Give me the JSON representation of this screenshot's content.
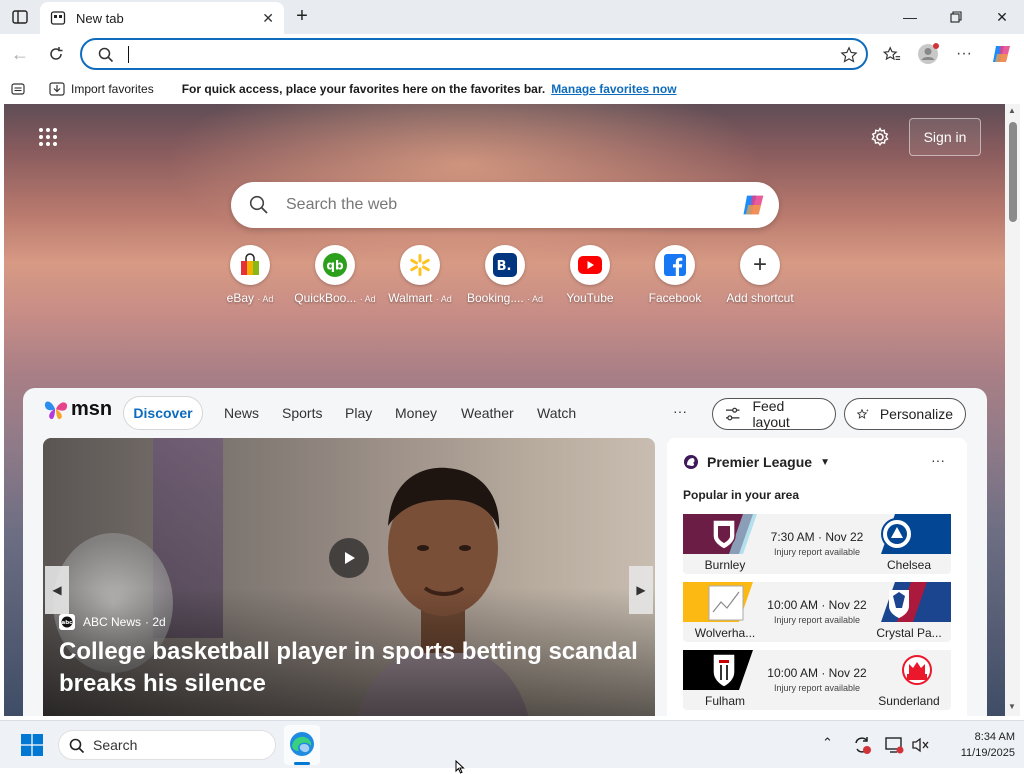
{
  "browser": {
    "tab_title": "New tab",
    "address_value": "",
    "favorites_bar": {
      "import_label": "Import favorites",
      "hint": "For quick access, place your favorites here on the favorites bar.",
      "manage_link": "Manage favorites now"
    }
  },
  "msn": {
    "sign_in": "Sign in",
    "search_placeholder": "Search the web",
    "shortcuts": [
      {
        "label": "eBay",
        "ad": "· Ad",
        "icon": "ebay-icon"
      },
      {
        "label": "QuickBoo...",
        "ad": "· Ad",
        "icon": "quickbooks-icon"
      },
      {
        "label": "Walmart",
        "ad": "· Ad",
        "icon": "walmart-icon"
      },
      {
        "label": "Booking....",
        "ad": "· Ad",
        "icon": "booking-icon"
      },
      {
        "label": "YouTube",
        "ad": "",
        "icon": "youtube-icon"
      },
      {
        "label": "Facebook",
        "ad": "",
        "icon": "facebook-icon"
      },
      {
        "label": "Add shortcut",
        "ad": "",
        "icon": "plus-icon"
      }
    ],
    "feed": {
      "logo": "msn",
      "tabs": [
        "Discover",
        "News",
        "Sports",
        "Play",
        "Money",
        "Weather",
        "Watch"
      ],
      "more": "···",
      "feed_layout": "Feed layout",
      "personalize": "Personalize",
      "hero": {
        "source": "ABC News",
        "age": "· 2d",
        "headline_line1": "College basketball player in sports betting scandal",
        "headline_line2": "breaks his silence"
      },
      "sports_card": {
        "league": "Premier League",
        "subtitle": "Popular in your area",
        "more": "···",
        "matches": [
          {
            "home": "Burnley",
            "away": "Chelsea",
            "time": "7:30 AM · Nov 22",
            "note": "Injury report available",
            "home_color": "#6c1d45",
            "away_color": "#034694"
          },
          {
            "home": "Wolverha...",
            "away": "Crystal Pa...",
            "time": "10:00 AM · Nov 22",
            "note": "Injury report available",
            "home_color": "#fdb913",
            "away_color": "#1b458f"
          },
          {
            "home": "Fulham",
            "away": "Sunderland",
            "time": "10:00 AM · Nov 22",
            "note": "Injury report available",
            "home_color": "#000000",
            "away_color": "#eb172b"
          }
        ]
      }
    }
  },
  "taskbar": {
    "search_label": "Search",
    "time": "8:34 AM",
    "date": "11/19/2025"
  },
  "colors": {
    "accent": "#0f6cbd",
    "msn_discover": "#0f6cbd"
  }
}
